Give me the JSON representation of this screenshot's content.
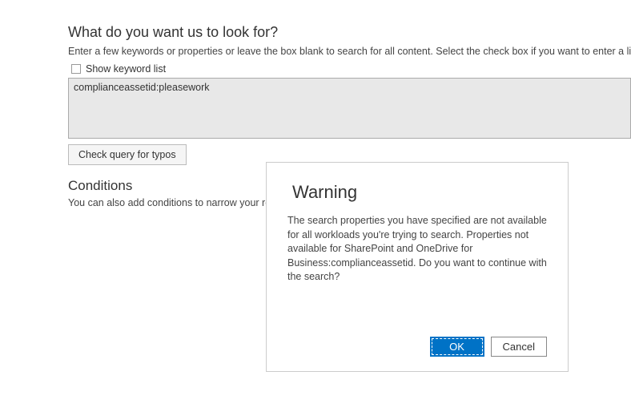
{
  "search": {
    "heading": "What do you want us to look for?",
    "subtext": "Enter a few keywords or properties or leave the box blank to search for all content. Select the check box if you want to enter a list of k",
    "show_keyword_list_label": "Show keyword list",
    "query_value": "complianceassetid:pleasework",
    "check_typos_label": "Check query for typos"
  },
  "conditions": {
    "heading": "Conditions",
    "subtext": "You can also add conditions to narrow your res"
  },
  "dialog": {
    "title": "Warning",
    "body": "The search properties you have specified are not available for all workloads you're trying to search. Properties not available for SharePoint and OneDrive for Business:complianceassetid. Do you want to continue with the search?",
    "ok_label": "OK",
    "cancel_label": "Cancel"
  }
}
